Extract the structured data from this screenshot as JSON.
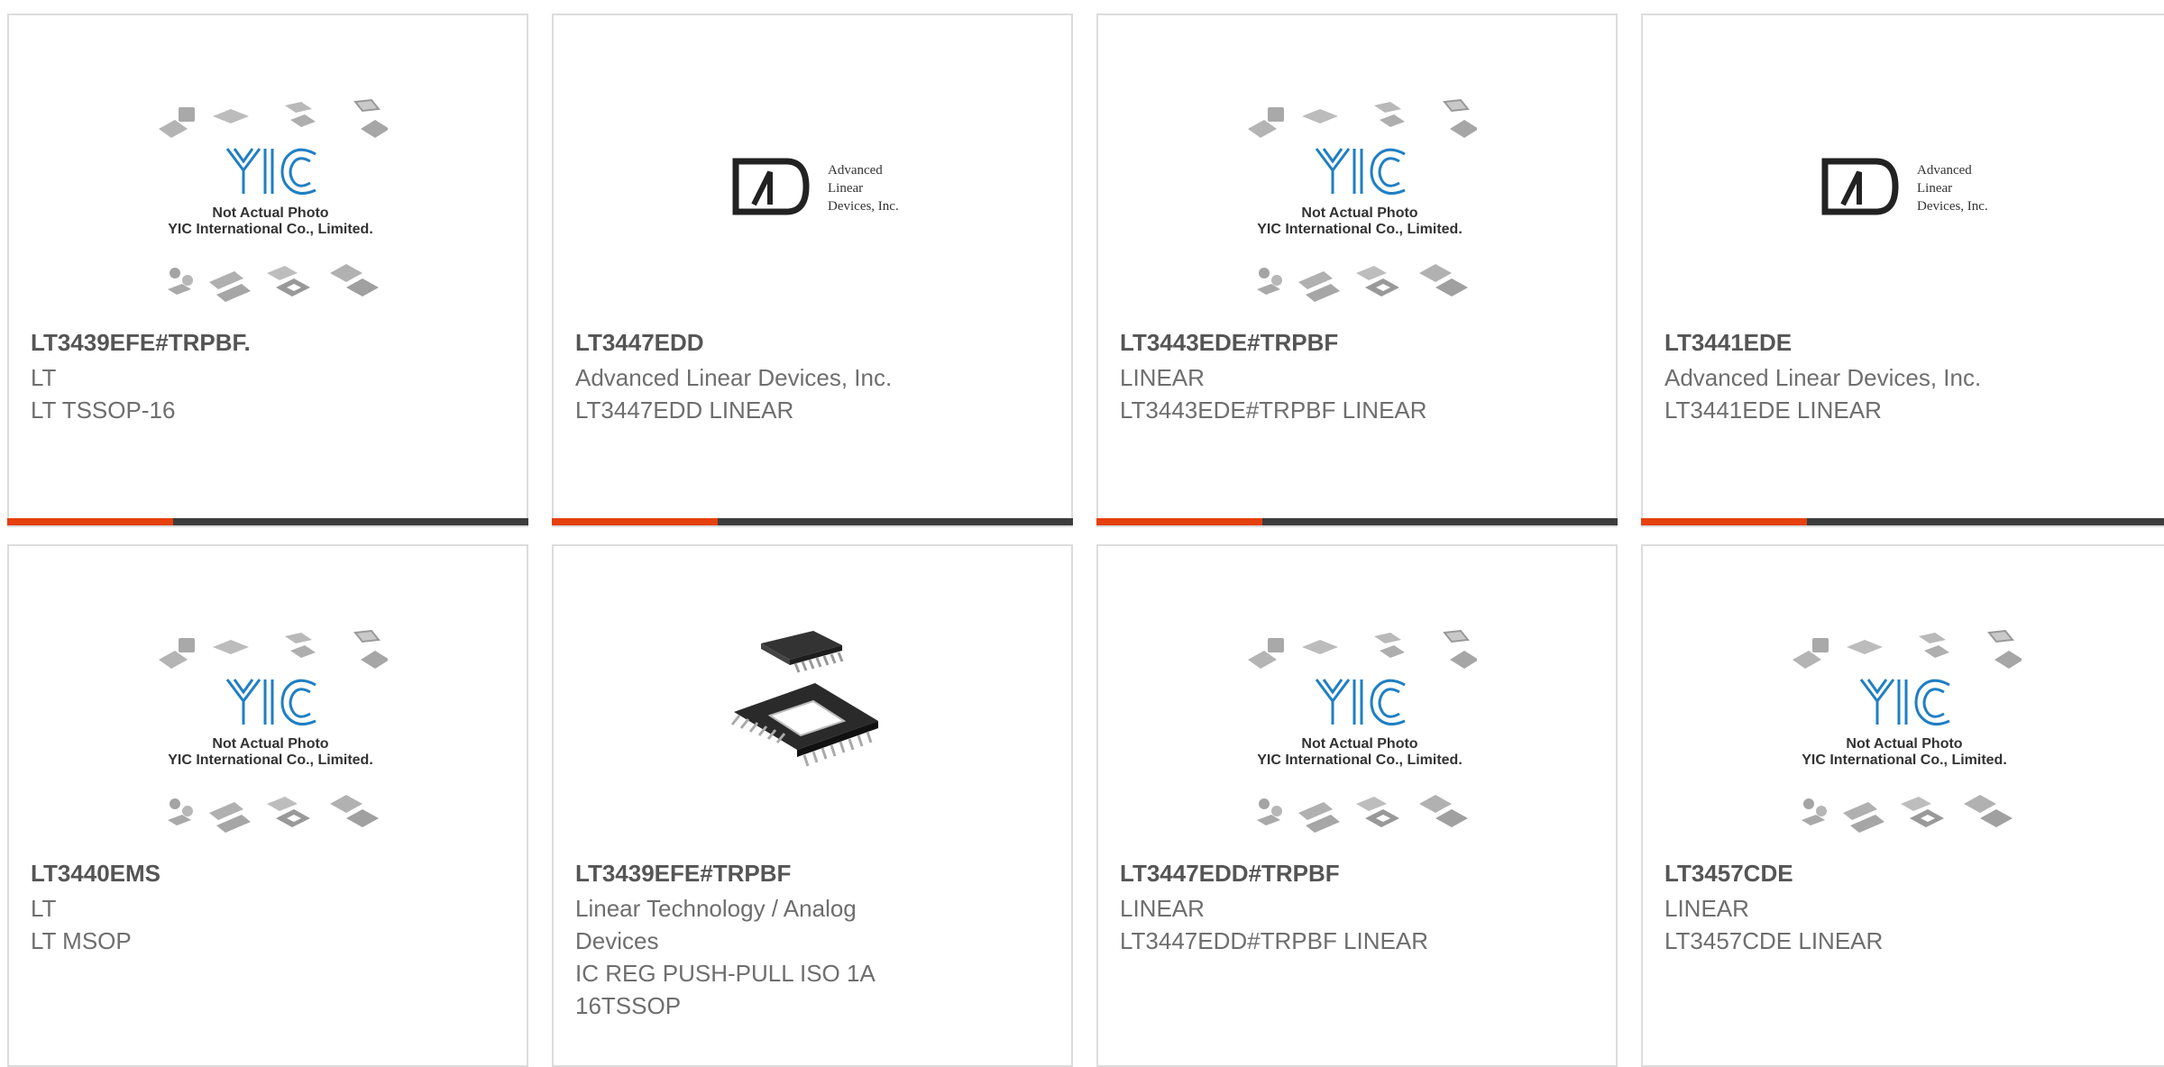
{
  "accent_color": "#e6400e",
  "bar_color": "#3d3d3d",
  "placeholder": {
    "line1": "Not Actual Photo",
    "line2": "YIC International Co., Limited.",
    "logo_text": "YIC"
  },
  "ald_logo": {
    "line1": "Advanced",
    "line2": "Linear",
    "line3": "Devices, Inc."
  },
  "products": [
    {
      "part": "LT3439EFE#TRPBF.",
      "maker": "LT",
      "desc": "LT TSSOP-16",
      "image": "yic-placeholder"
    },
    {
      "part": "LT3447EDD",
      "maker": "Advanced Linear Devices, Inc.",
      "desc": "LT3447EDD LINEAR",
      "image": "ald-logo"
    },
    {
      "part": "LT3443EDE#TRPBF",
      "maker": "LINEAR",
      "desc": "LT3443EDE#TRPBF LINEAR",
      "image": "yic-placeholder"
    },
    {
      "part": "LT3441EDE",
      "maker": "Advanced Linear Devices, Inc.",
      "desc": "LT3441EDE LINEAR",
      "image": "ald-logo"
    },
    {
      "part": "LT3440EMS",
      "maker": "LT",
      "desc": "LT MSOP",
      "image": "yic-placeholder"
    },
    {
      "part": "LT3439EFE#TRPBF",
      "maker": "Linear Technology / Analog Devices",
      "desc": "IC REG PUSH-PULL ISO 1A 16TSSOP",
      "image": "tssop-chip-photo"
    },
    {
      "part": "LT3447EDD#TRPBF",
      "maker": "LINEAR",
      "desc": "LT3447EDD#TRPBF LINEAR",
      "image": "yic-placeholder"
    },
    {
      "part": "LT3457CDE",
      "maker": "LINEAR",
      "desc": "LT3457CDE LINEAR",
      "image": "yic-placeholder"
    }
  ]
}
